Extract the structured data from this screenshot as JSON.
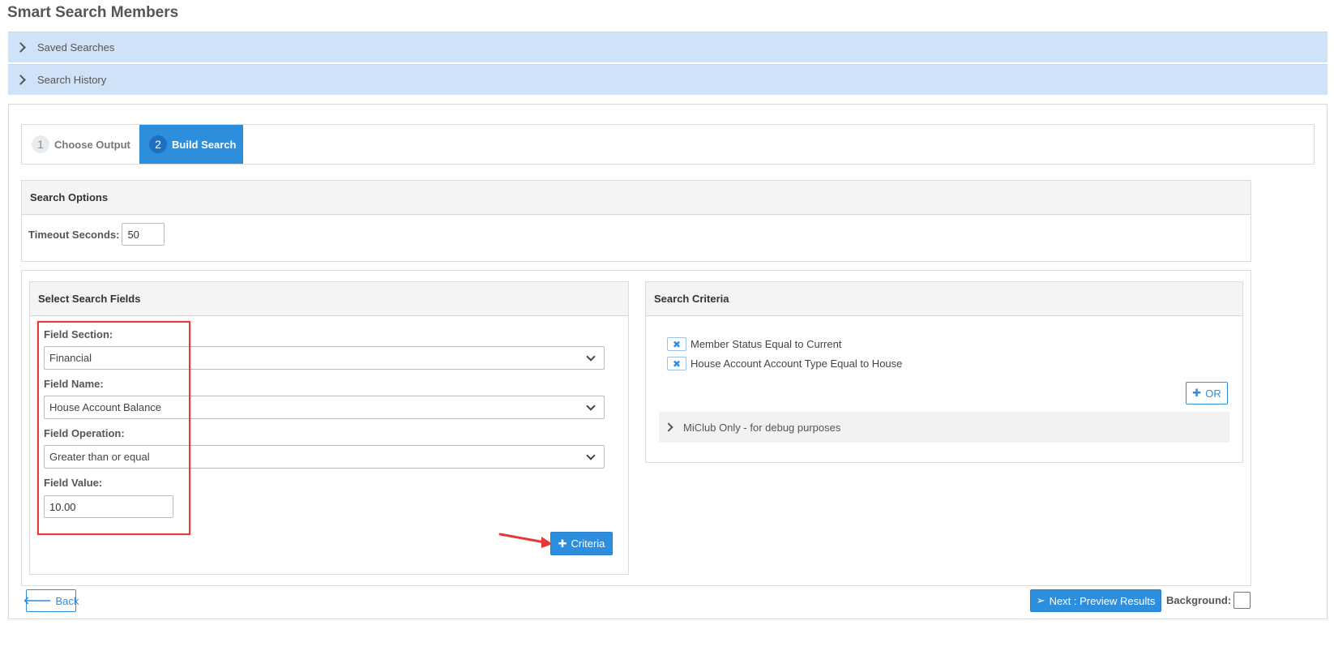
{
  "page": {
    "title": "Smart Search Members"
  },
  "accordions": [
    {
      "label": "Saved Searches"
    },
    {
      "label": "Search History"
    }
  ],
  "steps": [
    {
      "number": "1",
      "label": "Choose Output",
      "active": false
    },
    {
      "number": "2",
      "label": "Build Search",
      "active": true
    }
  ],
  "search_options": {
    "heading": "Search Options",
    "timeout_label": "Timeout Seconds:",
    "timeout_value": "50"
  },
  "search_fields": {
    "heading": "Select Search Fields",
    "section_label": "Field Section:",
    "section_value": "Financial",
    "name_label": "Field Name:",
    "name_value": "House Account Balance",
    "operation_label": "Field Operation:",
    "operation_value": "Greater than or equal",
    "value_label": "Field Value:",
    "value_value": "10.00",
    "add_button": "Criteria"
  },
  "search_criteria": {
    "heading": "Search Criteria",
    "items": [
      {
        "text": "Member Status Equal to Current"
      },
      {
        "text": "House Account Account Type Equal to House"
      }
    ],
    "or_button": "OR",
    "debug_label": "MiClub Only - for debug purposes"
  },
  "footer": {
    "back_label": "Back",
    "next_label": "Next : Preview Results",
    "background_label": "Background:"
  },
  "colors": {
    "accent": "#2e8ede",
    "accordion_bg": "#cfe2f7",
    "highlight": "#e53935"
  },
  "icons": {
    "remove": "close-icon",
    "plus": "plus-icon",
    "send": "paper-plane-icon",
    "back": "arrow-left-icon"
  }
}
